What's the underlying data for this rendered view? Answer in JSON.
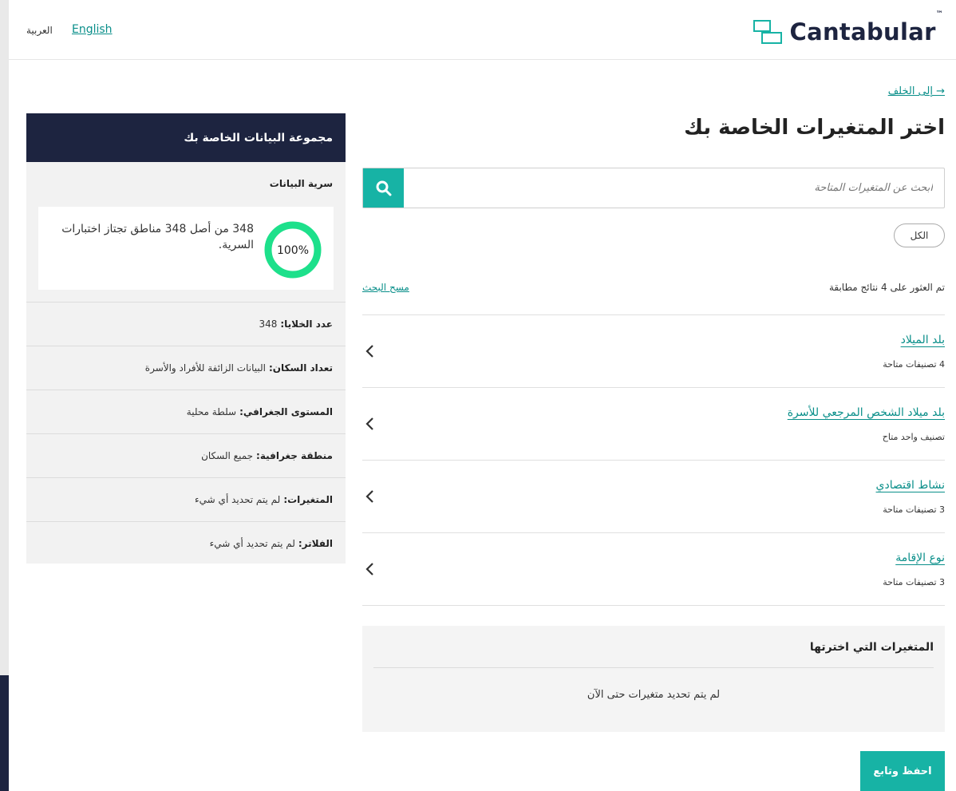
{
  "header": {
    "lang_english": "English",
    "lang_arabic": "العربية",
    "logo_text": "Cantabular",
    "logo_tm": "™"
  },
  "main": {
    "back_link": "→ إلى الخلف",
    "title": "اختر المتغيرات الخاصة بك",
    "search_placeholder": "ابحث عن المتغيرات المتاحة",
    "filter_chip": "الكل",
    "results_count": "تم العثور على 4 نتائج مطابقة",
    "clear_search": "مسح البحث",
    "variables": [
      {
        "title": "بلد الميلاد",
        "subtitle": "4 تصنيفات متاحة"
      },
      {
        "title": "بلد ميلاد الشخص المرجعي للأسرة",
        "subtitle": "تصنيف واحد متاح"
      },
      {
        "title": "نشاط اقتصادي",
        "subtitle": "3 تصنيفات متاحة"
      },
      {
        "title": "نوع الإقامة",
        "subtitle": "3 تصنيفات متاحة"
      }
    ],
    "selected": {
      "title": "المتغيرات التي اخترتها",
      "empty": "لم يتم تحديد متغيرات حتى الآن"
    },
    "save_button": "احفظ وتابع"
  },
  "panel": {
    "title": "مجموعة البيانات الخاصة بك",
    "confidentiality_title": "سرية البيانات",
    "confidentiality_percent": "100%",
    "confidentiality_text": "348 من أصل 348 مناطق تجتاز اختبارات السرية.",
    "rows": [
      {
        "label": "عدد الخلايا:",
        "value": "348"
      },
      {
        "label": "تعداد السكان:",
        "value": "البيانات الزائفة للأفراد والأسرة"
      },
      {
        "label": "المستوى الجغرافي:",
        "value": "سلطة محلية"
      },
      {
        "label": "منطقة جغرافية:",
        "value": "جميع السكان"
      },
      {
        "label": "المتغيرات:",
        "value": "لم يتم تحديد أي شيء"
      },
      {
        "label": "الفلاتر:",
        "value": "لم يتم تحديد أي شيء"
      }
    ]
  },
  "colors": {
    "accent": "#17b3a5",
    "navy": "#1d2440",
    "donut": "#1de08b",
    "link": "#0a8f8a"
  }
}
